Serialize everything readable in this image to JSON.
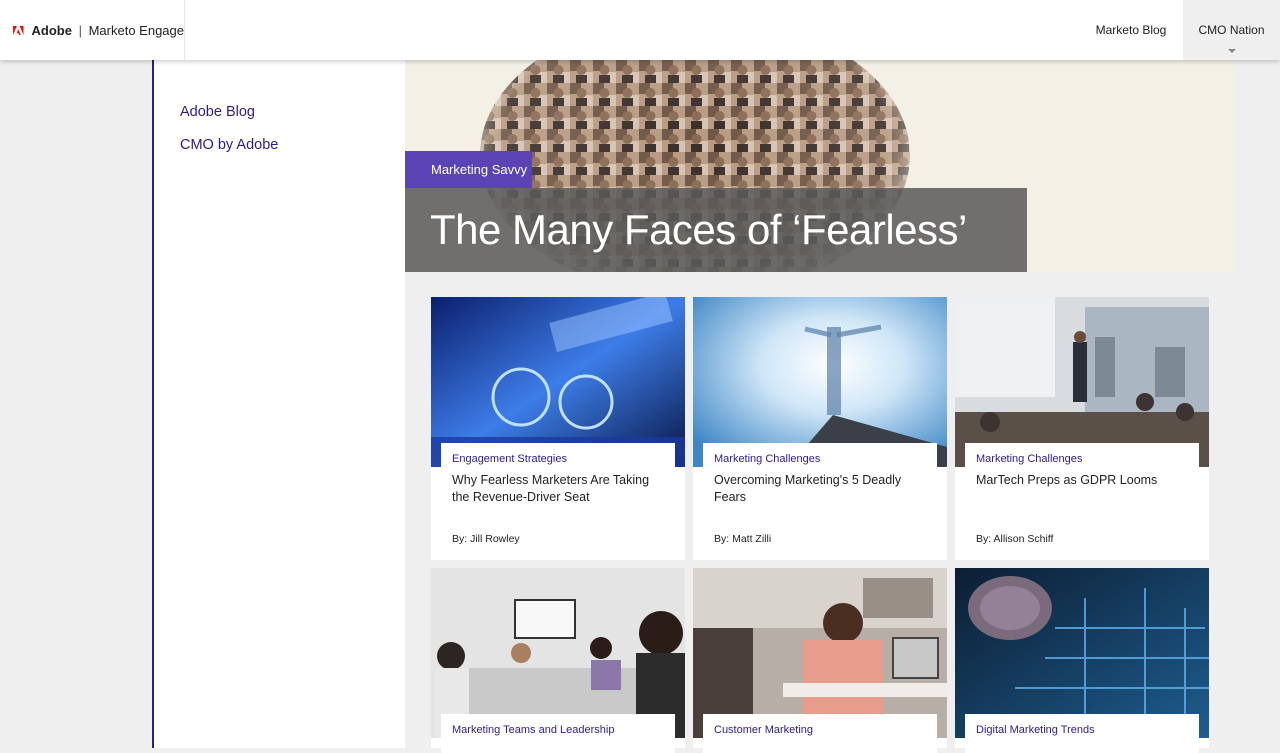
{
  "header": {
    "brand_company": "Adobe",
    "brand_separator": "|",
    "brand_product": "Marketo Engage",
    "nav": [
      {
        "label": "Marketo Blog"
      },
      {
        "label": "CMO Nation"
      }
    ]
  },
  "sidebar": {
    "links": [
      {
        "label": "Adobe Blog"
      },
      {
        "label": "CMO by Adobe"
      }
    ]
  },
  "hero": {
    "tag": "Marketing Savvy",
    "title": "The Many Faces of ‘Fearless’"
  },
  "cards": [
    {
      "category": "Engagement Strategies",
      "title": "Why Fearless Marketers Are Taking the Revenue-Driver Seat",
      "author": "By: Jill Rowley"
    },
    {
      "category": "Marketing Challenges",
      "title": "Overcoming Marketing's 5 Deadly Fears",
      "author": "By: Matt Zilli"
    },
    {
      "category": "Marketing Challenges",
      "title": "MarTech Preps as GDPR Looms",
      "author": "By: Allison Schiff"
    },
    {
      "category": "Marketing Teams and Leadership",
      "title": "",
      "author": ""
    },
    {
      "category": "Customer Marketing",
      "title": "",
      "author": ""
    },
    {
      "category": "Digital Marketing Trends",
      "title": "",
      "author": ""
    }
  ],
  "colors": {
    "accent": "#2d1c8c",
    "tag_bg": "#5a44b3",
    "adobe_red": "#eb1000"
  }
}
